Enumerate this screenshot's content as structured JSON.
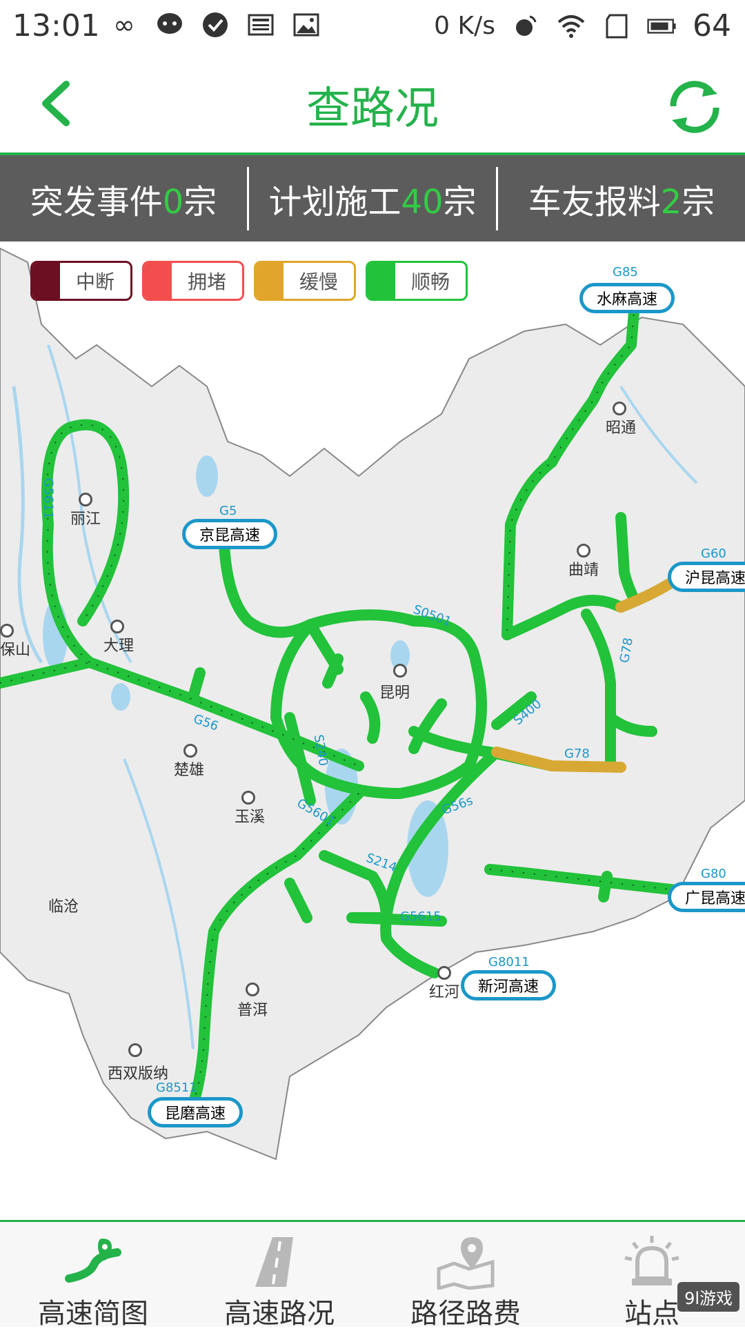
{
  "status": {
    "time": "13:01",
    "net_speed": "0 K/s",
    "battery": "64"
  },
  "header": {
    "title": "查路况"
  },
  "stats": [
    {
      "pre": "突发事件",
      "num": "0",
      "post": "宗"
    },
    {
      "pre": "计划施工",
      "num": "40",
      "post": "宗"
    },
    {
      "pre": "车友报料",
      "num": "2",
      "post": "宗"
    }
  ],
  "legend": [
    {
      "label": "中断",
      "color": "#6d0f22"
    },
    {
      "label": "拥堵",
      "color": "#f24e4e"
    },
    {
      "label": "缓慢",
      "color": "#e0a52a"
    },
    {
      "label": "顺畅",
      "color": "#22c23a"
    }
  ],
  "highways": {
    "shuima": {
      "code": "G85",
      "name": "水麻高速"
    },
    "jingkun": {
      "code": "G5",
      "name": "京昆高速"
    },
    "hukun": {
      "code": "G60",
      "name": "沪昆高速"
    },
    "guangkun": {
      "code": "G80",
      "name": "广昆高速"
    },
    "xinhe": {
      "code": "G8011",
      "name": "新河高速"
    },
    "kunmo": {
      "code": "G8511",
      "name": "昆磨高速"
    }
  },
  "cities": {
    "lijiang": "丽江",
    "dali": "大理",
    "baoshan": "保山",
    "chuxiong": "楚雄",
    "yuxi": "玉溪",
    "kunming": "昆明",
    "qujing": "曲靖",
    "zhaotong": "昭通",
    "lincang": "临沧",
    "puer": "普洱",
    "xishuangbanna": "西双版纳",
    "honghe": "红河"
  },
  "route_codes": {
    "g5611": "G5611",
    "s0501": "S0501",
    "g78": "G78",
    "s400": "S400",
    "g78b": "G78",
    "g56": "G56",
    "s240": "S240",
    "g5601": "G5601",
    "g56s": "G56s",
    "s214": "S214",
    "g5615": "G5615"
  },
  "nav": [
    {
      "label": "高速简图"
    },
    {
      "label": "高速路况"
    },
    {
      "label": "路径路费"
    },
    {
      "label": "站点"
    }
  ],
  "watermark": "9l游戏",
  "colors": {
    "accent": "#24b24b",
    "road": "#22c23a",
    "slow": "#d8a834",
    "route_code": "#1b97c9"
  }
}
